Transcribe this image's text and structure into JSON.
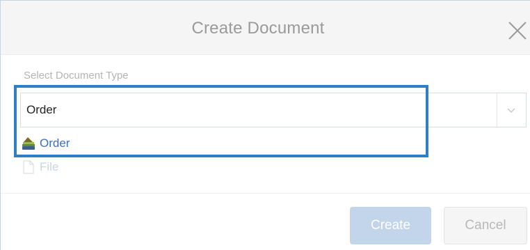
{
  "dialog": {
    "title": "Create Document",
    "close_icon": "close-icon"
  },
  "field": {
    "label": "Select Document Type",
    "value": "Order",
    "dropdown_icon": "chevron-down-icon"
  },
  "options": [
    {
      "label": "Order",
      "icon": "order-icon",
      "color": "#3e6fc2"
    },
    {
      "label": "File",
      "icon": "file-icon",
      "color": "#c8d4e6"
    }
  ],
  "buttons": {
    "create_label": "Create",
    "cancel_label": "Cancel"
  },
  "colors": {
    "highlight": "#2d7fc6",
    "primary_disabled": "#c2d5ea"
  }
}
